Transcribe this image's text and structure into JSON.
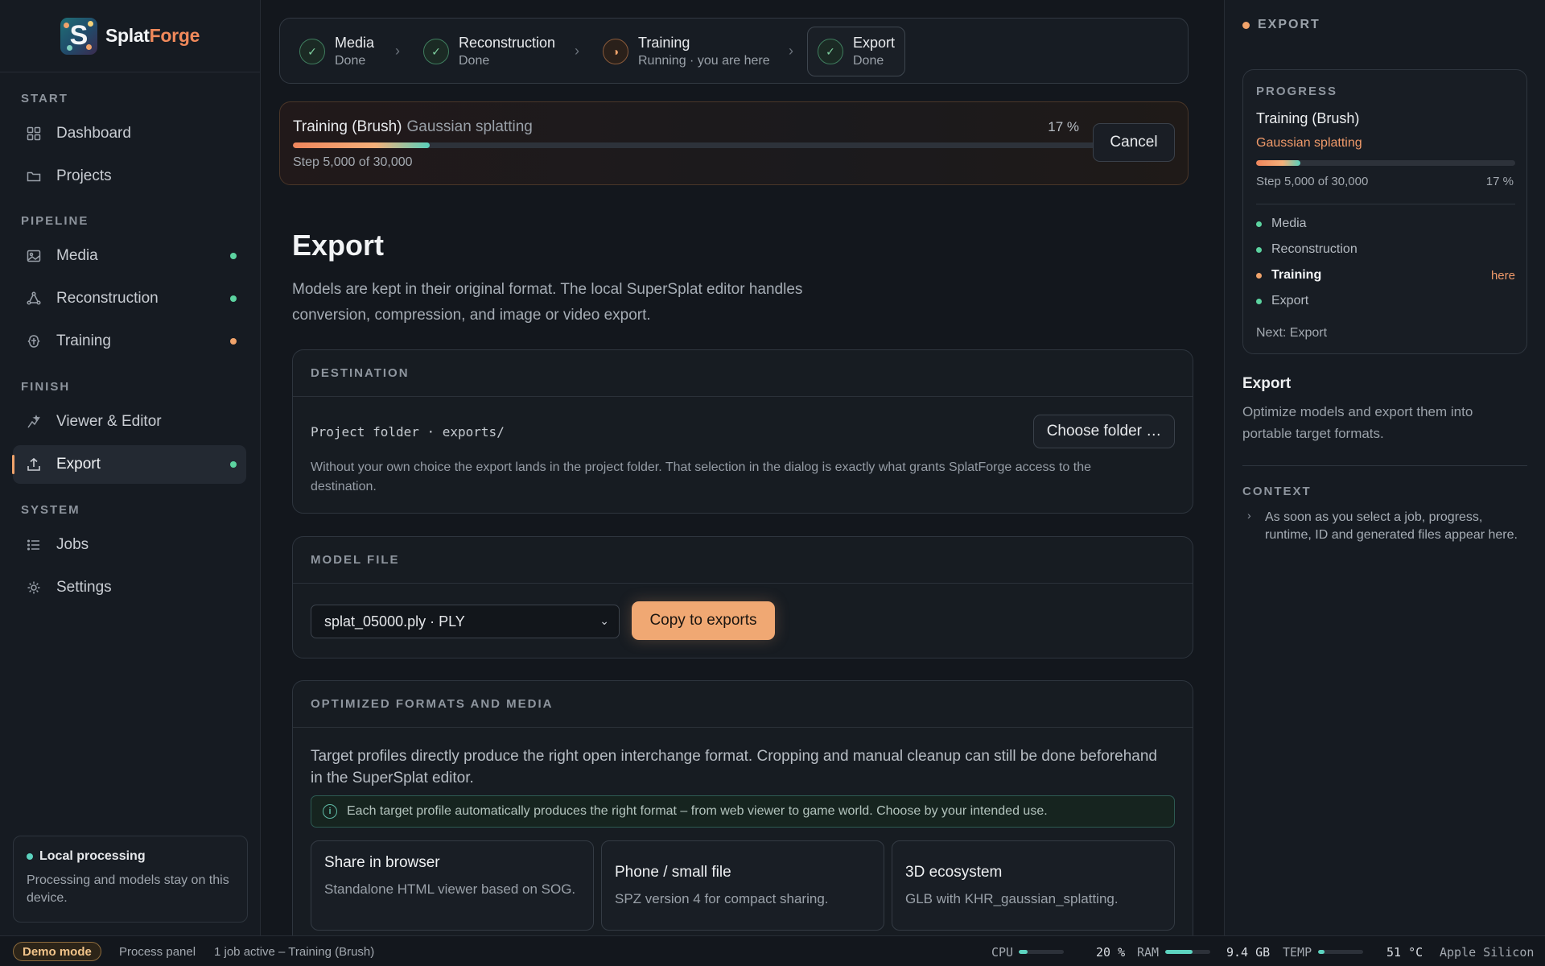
{
  "app": {
    "brand_first": "Splat",
    "brand_second": "Forge",
    "logo_letter": "S"
  },
  "sidebar": {
    "sections": {
      "start": "START",
      "pipeline": "PIPELINE",
      "finish": "FINISH",
      "system": "SYSTEM"
    },
    "items": [
      {
        "label": "Dashboard",
        "icon": "grid-icon"
      },
      {
        "label": "Projects",
        "icon": "folder-icon"
      },
      {
        "label": "Media",
        "icon": "image-icon",
        "status": "done"
      },
      {
        "label": "Reconstruction",
        "icon": "nodes-icon",
        "status": "done"
      },
      {
        "label": "Training",
        "icon": "brain-icon",
        "status": "running"
      },
      {
        "label": "Viewer & Editor",
        "icon": "sparkle-icon"
      },
      {
        "label": "Export",
        "icon": "upload-icon",
        "status": "done",
        "active": true
      },
      {
        "label": "Jobs",
        "icon": "list-icon"
      },
      {
        "label": "Settings",
        "icon": "gear-icon"
      }
    ],
    "local": {
      "title": "Local processing",
      "desc": "Processing and models stay on this device."
    }
  },
  "stepper": [
    {
      "title": "Media",
      "sub": "Done",
      "state": "done"
    },
    {
      "title": "Reconstruction",
      "sub": "Done",
      "state": "done"
    },
    {
      "title": "Training",
      "sub": "Running · you are here",
      "state": "running"
    },
    {
      "title": "Export",
      "sub": "Done",
      "state": "done",
      "current": true
    }
  ],
  "training": {
    "title": "Training (Brush)",
    "subtitle": "Gaussian splatting",
    "percent_label": "17 %",
    "progress": 0.17,
    "step": "Step 5,000 of 30,000",
    "cancel": "Cancel"
  },
  "page": {
    "title": "Export",
    "desc": "Models are kept in their original format. The local SuperSplat editor handles conversion, compression, and image or video export."
  },
  "destination": {
    "header": "DESTINATION",
    "path": "Project folder · exports/",
    "choose": "Choose folder …",
    "note": "Without your own choice the export lands in the project folder. That selection in the dialog is exactly what grants SplatForge access to the destination."
  },
  "model": {
    "header": "MODEL FILE",
    "selected": "splat_05000.ply · PLY",
    "copy": "Copy to exports"
  },
  "optimized": {
    "header": "OPTIMIZED FORMATS AND MEDIA",
    "intro": "Target profiles directly produce the right open interchange format. Cropping and manual cleanup can still be done beforehand in the SuperSplat editor.",
    "info": "Each target profile automatically produces the right format – from web viewer to game world. Choose by your intended use.",
    "profiles": [
      {
        "title": "Share in browser",
        "desc": "Standalone HTML viewer based on SOG."
      },
      {
        "title": "Phone / small file",
        "desc": "SPZ version 4 for compact sharing."
      },
      {
        "title": "3D ecosystem",
        "desc": "GLB with KHR_gaussian_splatting."
      }
    ]
  },
  "right_panel": {
    "header": "EXPORT",
    "progress_label": "PROGRESS",
    "title": "Training (Brush)",
    "subtitle": "Gaussian splatting",
    "step": "Step 5,000 of 30,000",
    "percent": "17 %",
    "progress": 0.17,
    "pipeline": [
      {
        "label": "Media",
        "state": "done"
      },
      {
        "label": "Reconstruction",
        "state": "done"
      },
      {
        "label": "Training",
        "state": "running",
        "tag": "here"
      },
      {
        "label": "Export",
        "state": "done"
      }
    ],
    "next": "Next: Export",
    "section_title": "Export",
    "section_desc": "Optimize models and export them into portable target formats.",
    "context_label": "CONTEXT",
    "context_text": "As soon as you select a job, progress, runtime, ID and generated files appear here."
  },
  "statusbar": {
    "demo": "Demo mode",
    "process_panel": "Process panel",
    "jobs": "1 job active – Training (Brush)",
    "cpu_label": "CPU",
    "cpu_value": "20 %",
    "cpu_fraction": 0.2,
    "ram_label": "RAM",
    "ram_value": "9.4 GB",
    "ram_fraction": 0.6,
    "temp_label": "TEMP",
    "temp_value": "51 °C",
    "temp_fraction": 0.15,
    "chip": "Apple Silicon"
  },
  "colors": {
    "accent": "#f0a36b",
    "done": "#5cd3a0",
    "running": "#f0a36b",
    "teal": "#5cd3bf"
  }
}
